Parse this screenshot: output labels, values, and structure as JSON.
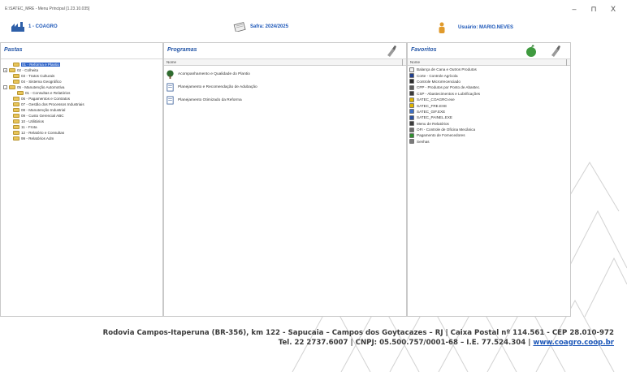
{
  "window": {
    "title": "E:\\SATEC_MRE - Menu Principal [1.23.10.035]",
    "controls": {
      "minimize": "–",
      "maximize": "⊓",
      "close": "X"
    }
  },
  "infobar": {
    "company": "1 - COAGRO",
    "harvest": "Safra: 2024/2025",
    "user": "Usuário: MARIO.NEVES"
  },
  "pastas": {
    "title": "Pastas",
    "column": "",
    "items": [
      {
        "label": "01 - Reforma e Plantio",
        "expander": "",
        "selected": true,
        "indent": 1
      },
      {
        "label": "02 - Colheita",
        "expander": "+",
        "selected": false,
        "indent": 0
      },
      {
        "label": "03 - Tratos Culturais",
        "expander": "",
        "selected": false,
        "indent": 1
      },
      {
        "label": "04 - Sistema Geográfico",
        "expander": "",
        "selected": false,
        "indent": 1
      },
      {
        "label": "05 - Manutenção Automotiva",
        "expander": "-",
        "selected": false,
        "indent": 0
      },
      {
        "label": "01 - Consultas e Relatórios",
        "expander": "",
        "selected": false,
        "indent": 2
      },
      {
        "label": "06 - Pagamentos e Contratos",
        "expander": "",
        "selected": false,
        "indent": 1
      },
      {
        "label": "07 - Gestão dos Processos Industriais",
        "expander": "",
        "selected": false,
        "indent": 1
      },
      {
        "label": "08 - Manutenção Industrial",
        "expander": "",
        "selected": false,
        "indent": 1
      },
      {
        "label": "09 - Custo Gerencial ABC",
        "expander": "",
        "selected": false,
        "indent": 1
      },
      {
        "label": "10 - Utilitários",
        "expander": "",
        "selected": false,
        "indent": 1
      },
      {
        "label": "11 - Frota",
        "expander": "",
        "selected": false,
        "indent": 1
      },
      {
        "label": "12 - Relatório e Consultas",
        "expander": "",
        "selected": false,
        "indent": 1
      },
      {
        "label": "99 - Relatórios Adm",
        "expander": "",
        "selected": false,
        "indent": 1
      }
    ]
  },
  "programas": {
    "title": "Programas",
    "column": "Nome",
    "items": [
      {
        "label": "Acompanhamento e Qualidade do Plantio",
        "icon": "tree-icon"
      },
      {
        "label": "Planejamento e Recomendação de Adubação",
        "icon": "document-icon"
      },
      {
        "label": "Planejamento Otimizado da Reforma",
        "icon": "document-icon"
      }
    ]
  },
  "favoritos": {
    "title": "Favoritos",
    "column": "Nome",
    "items": [
      {
        "label": "Balança de Cana e Outros Produtos",
        "color": "#f2f2f2"
      },
      {
        "label": "Corte - Controle Agrícola",
        "color": "#1f3f8f"
      },
      {
        "label": "Controle Microrrecenciado",
        "color": "#2a2a2a"
      },
      {
        "label": "CPP - Produtos por Ponto de Abastec.",
        "color": "#5a5a5a"
      },
      {
        "label": "CSP - Abastecimentos e Lubrificações",
        "color": "#3b3b3b"
      },
      {
        "label": "SATEC_COAGRO.exe",
        "color": "#e0b400"
      },
      {
        "label": "SATEC_FRE.EXE",
        "color": "#e0b400"
      },
      {
        "label": "SATEC_GIF.EXE",
        "color": "#3d6fc4"
      },
      {
        "label": "SATEC_PAINEL.EXE",
        "color": "#2a4f9e"
      },
      {
        "label": "Menu de Relatórios",
        "color": "#3c3c3c"
      },
      {
        "label": "OFI - Controle de Oficina Mecânica",
        "color": "#6b6b6b"
      },
      {
        "label": "Pagamento de Fornecedores",
        "color": "#2f8f2f"
      },
      {
        "label": "Senhas",
        "color": "#7a7a7a"
      }
    ]
  },
  "footer": {
    "line1": "Rodovia Campos-Itaperuna (BR-356), km 122 - Sapucaia – Campos dos Goytacazes – RJ | Caixa Postal nº 114.561 - CEP 28.010-972",
    "line2": "Tel. 22 2737.6007 | CNPJ: 05.500.757/0001-68 – I.E. 77.524.304 |",
    "link": "www.coagro.coop.br"
  },
  "colors": {
    "accent": "#1b56b8",
    "selection": "#2f64c8",
    "folder": "#e8c55a"
  }
}
